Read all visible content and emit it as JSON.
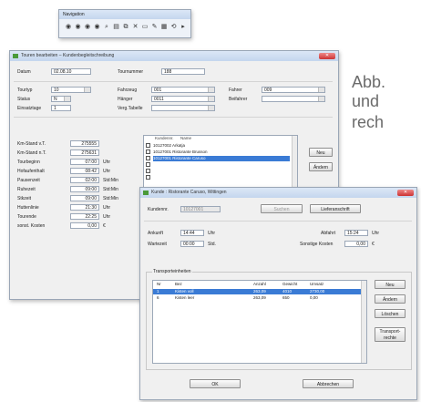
{
  "side_text": [
    "Abb.",
    "und",
    "rech"
  ],
  "nav_toolbar": {
    "title": "Navigation",
    "icons": [
      "circle-first-icon",
      "circle-prev-icon",
      "circle-next-icon",
      "circle-last-icon",
      "search-icon",
      "new-doc-icon",
      "copy-icon",
      "delete-icon",
      "print-preview-icon",
      "edit-icon",
      "calendar-icon",
      "refresh-icon",
      "play-icon"
    ],
    "glyphs": [
      "◉",
      "◉",
      "◉",
      "◉",
      "⌕",
      "▤",
      "⧉",
      "✕",
      "▭",
      "✎",
      "▦",
      "⟲",
      "▸"
    ]
  },
  "tour_window": {
    "title": "Touren bearbeiten – Kundenbegleitschreibung",
    "datum_label": "Datum",
    "datum_value": "02.08.10",
    "tournummer_label": "Tournummer",
    "tournummer_value": "188",
    "tourtyp_label": "Tourtyp",
    "tourtyp_value": "10",
    "status_label": "Status",
    "status_value": "N",
    "einsatztage_label": "Einsatztage",
    "einsatztage_value": "1",
    "fahrzeug_label": "Fahrzeug",
    "fahrzeug_value": "001",
    "anhaenger_label": "Hänger",
    "anhaenger_value": "0011",
    "vergtabelle_label": "Verg.Tabelle",
    "fahrer_label": "Fahrer",
    "fahrer_value": "009",
    "beifahrer_label": "Beifahrer",
    "time_rows": [
      {
        "label": "Km-Stand v.T.",
        "value": "275555",
        "unit": ""
      },
      {
        "label": "Km-Stand n.T.",
        "value": "275631",
        "unit": ""
      },
      {
        "label": "Tourbeginn",
        "value": "07:00",
        "unit": "Uhr"
      },
      {
        "label": "Hofaufenthalt",
        "value": "08:42",
        "unit": "Uhr"
      },
      {
        "label": "Pausenzeit",
        "value": "02:00",
        "unit": "Std:Min"
      },
      {
        "label": "Ruhezeit",
        "value": "09:00",
        "unit": "Std:Min"
      },
      {
        "label": "Stkzeit",
        "value": "09:00",
        "unit": "Std:Min"
      },
      {
        "label": "Huttenlinie",
        "value": "21:30",
        "unit": "Uhr"
      },
      {
        "label": "Tourende",
        "value": "22:25",
        "unit": "Uhr"
      },
      {
        "label": "sonst. Kosten",
        "value": "0,00",
        "unit": "€"
      }
    ],
    "kunden_header": [
      "Kundennr.",
      "Name"
    ],
    "kunden": [
      {
        "text": "10127002 Arkatja",
        "selected": false
      },
      {
        "text": "10127001 Ristorante Brusson",
        "selected": false
      },
      {
        "text": "10127001 Ristorante Caruso",
        "selected": true
      }
    ],
    "btn_neu": "Neu",
    "btn_aendern": "Ändern"
  },
  "customer_window": {
    "title": "Kunde : Ristorante Caruso, Wittingen",
    "kundennr_label": "Kundennr.",
    "kundennr_value": "10127001",
    "btn_suchen": "Suchen",
    "btn_lieferanschrift": "Lieferanschrift",
    "ankunft_label": "Ankunft",
    "ankunft_value": "14:44",
    "ankunft_unit": "Uhr",
    "abfahrt_label": "Abfahrt",
    "abfahrt_value": "15:24",
    "abfahrt_unit": "Uhr",
    "wartezeit_label": "Wartezeit",
    "wartezeit_value": "00:00",
    "wartezeit_unit": "Std.",
    "sonstige_label": "Sonstige Kosten",
    "sonstige_value": "0,00",
    "sonstige_unit": "€",
    "group_title": "Transporteinheiten",
    "columns": [
      "Nr",
      "Bez",
      "Anzahl",
      "Gewicht",
      "Umsatz"
    ],
    "rows": [
      {
        "nr": "1",
        "bez": "Kisten voll",
        "anzahl": "263,09",
        "gewicht": "4010",
        "umsatz": "2730,00",
        "selected": true
      },
      {
        "nr": "6",
        "bez": "Kisten leer",
        "anzahl": "263,09",
        "gewicht": "650",
        "umsatz": "0,00",
        "selected": false
      }
    ],
    "side_buttons": [
      "Neu",
      "Ändern",
      "Löschen",
      "Transport-rechte"
    ],
    "btn_ok": "OK",
    "btn_abbrechen": "Abbrechen"
  },
  "colors": {
    "selection": "#3a7bd5",
    "title_gradient_top": "#dbe7f6",
    "side_text": "#6b6b6b"
  }
}
